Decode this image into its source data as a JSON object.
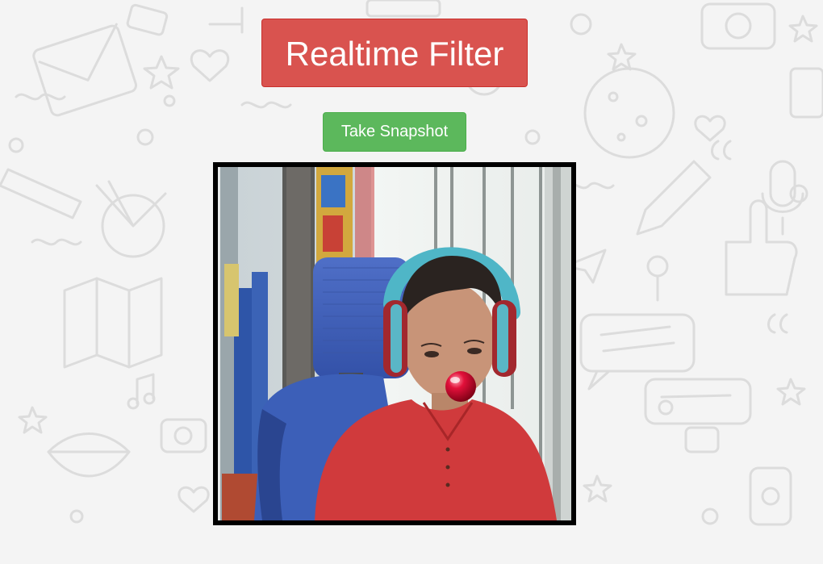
{
  "header": {
    "title": "Realtime Filter"
  },
  "controls": {
    "snapshot_label": "Take Snapshot"
  },
  "video": {
    "filter": "red-clown-nose"
  },
  "colors": {
    "title_bg": "#d9534f",
    "snapshot_bg": "#5cb85c",
    "frame_border": "#000000",
    "nose": "#d8002a"
  }
}
